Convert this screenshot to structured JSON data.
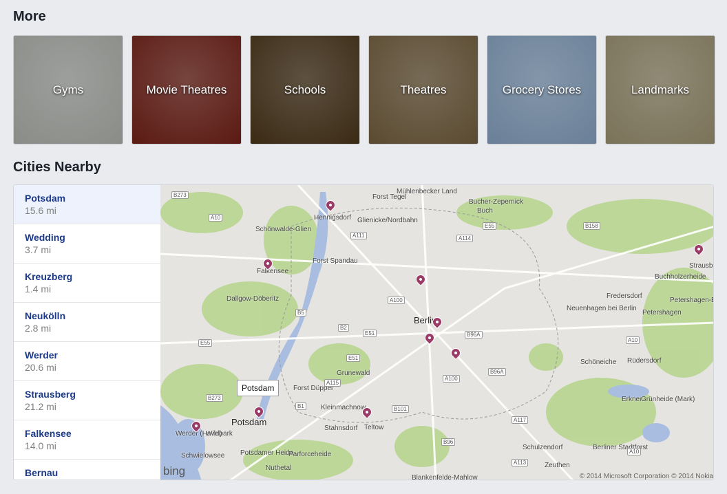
{
  "more": {
    "title": "More",
    "tiles": [
      {
        "label": "Gyms",
        "color": "#8a8c88"
      },
      {
        "label": "Movie Theatres",
        "color": "#5a1a12"
      },
      {
        "label": "Schools",
        "color": "#3a2a14"
      },
      {
        "label": "Theatres",
        "color": "#5a4a30"
      },
      {
        "label": "Grocery Stores",
        "color": "#6a8098"
      },
      {
        "label": "Landmarks",
        "color": "#7a7258"
      }
    ]
  },
  "cities": {
    "title": "Cities Nearby",
    "items": [
      {
        "name": "Potsdam",
        "distance": "15.6 mi"
      },
      {
        "name": "Wedding",
        "distance": "3.7 mi"
      },
      {
        "name": "Kreuzberg",
        "distance": "1.4 mi"
      },
      {
        "name": "Neukölln",
        "distance": "2.8 mi"
      },
      {
        "name": "Werder",
        "distance": "20.6 mi"
      },
      {
        "name": "Strausberg",
        "distance": "21.2 mi"
      },
      {
        "name": "Falkensee",
        "distance": "14.0 mi"
      },
      {
        "name": "Bernau",
        "distance": ""
      }
    ]
  },
  "map": {
    "tooltip": "Potsdam",
    "brand": "bing",
    "copyright": "© 2014 Microsoft Corporation © 2014 Nokia",
    "labels": [
      "Mühlenbecker Land",
      "Forst Tegel",
      "Bucher-Zepernick",
      "Buch",
      "Hennigsdorf",
      "Glienicke/Nordbahn",
      "Schönwalde-Glien",
      "Forst Spandau",
      "Falkensee",
      "Dallgow-Döberitz",
      "Berlin",
      "Fredersdorf",
      "Neuenhagen bei Berlin",
      "Petershagen",
      "Strausberg",
      "Buchholzerheide",
      "Petershagen-E",
      "Grunewald",
      "Schöneiche",
      "Rüdersdorf",
      "Forst Düppel",
      "Kleinmachnow",
      "Stahnsdorf",
      "Teltow",
      "Potsdam",
      "Wildpark",
      "Werder (Havel)",
      "Schwielowsee",
      "Potsdamer Heide",
      "Parforceheide",
      "Nuthetal",
      "Schulzendorf",
      "Berliner Stadtforst",
      "Erkner",
      "Grünheide (Mark)",
      "Zeuthen",
      "Blankenfelde-Mahlow"
    ],
    "roads": [
      "B273",
      "A10",
      "A111",
      "A114",
      "E55",
      "B158",
      "A100",
      "B5",
      "B2",
      "E51",
      "B96A",
      "E55",
      "A115",
      "B1",
      "B101",
      "B96",
      "A113",
      "A117",
      "A10",
      "A100",
      "E51",
      "B96A",
      "A10",
      "B273"
    ],
    "pin_color": "#9a3c67",
    "water_color": "#a9bde0",
    "park_color": "#b7d58f"
  }
}
